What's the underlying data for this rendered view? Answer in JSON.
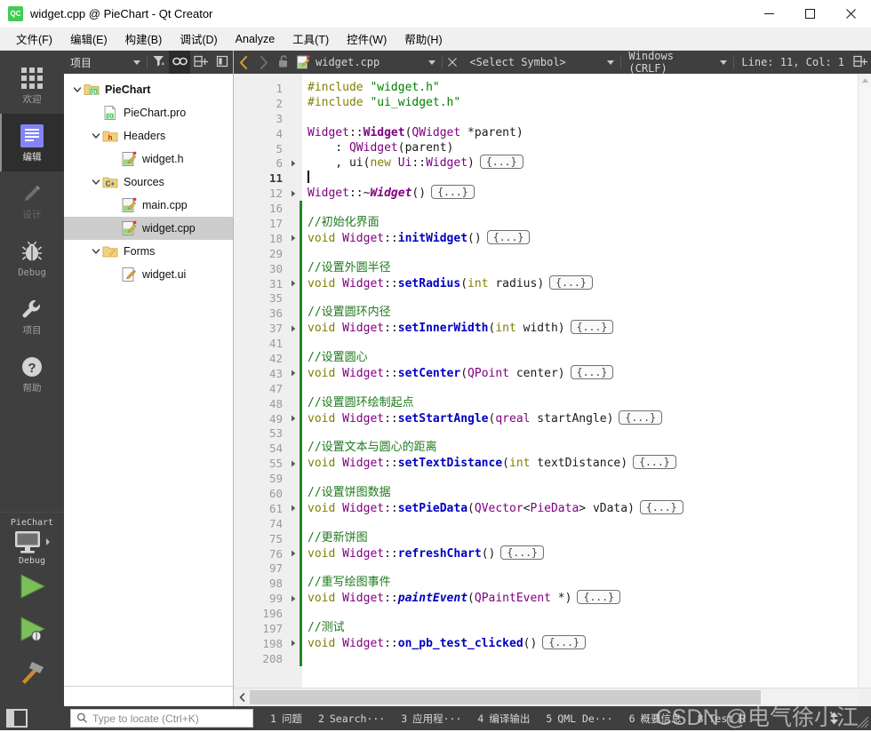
{
  "window": {
    "title": "widget.cpp @ PieChart - Qt Creator",
    "logo_text": "QC",
    "minimize_label": "Minimize",
    "maximize_label": "Maximize",
    "close_label": "Close"
  },
  "menubar": {
    "items": [
      {
        "label": "文件(F)",
        "name": "menu-file"
      },
      {
        "label": "编辑(E)",
        "name": "menu-edit"
      },
      {
        "label": "构建(B)",
        "name": "menu-build"
      },
      {
        "label": "调试(D)",
        "name": "menu-debug"
      },
      {
        "label": "Analyze",
        "name": "menu-analyze"
      },
      {
        "label": "工具(T)",
        "name": "menu-tools"
      },
      {
        "label": "控件(W)",
        "name": "menu-window"
      },
      {
        "label": "帮助(H)",
        "name": "menu-help"
      }
    ]
  },
  "modebar": {
    "modes": [
      {
        "label": "欢迎",
        "icon": "grid-icon",
        "state": "normal"
      },
      {
        "label": "编辑",
        "icon": "edit-lines-icon",
        "state": "active"
      },
      {
        "label": "设计",
        "icon": "pencil-icon",
        "state": "disabled"
      },
      {
        "label": "Debug",
        "icon": "bug-icon",
        "state": "normal"
      },
      {
        "label": "项目",
        "icon": "wrench-icon",
        "state": "normal"
      },
      {
        "label": "帮助",
        "icon": "question-circle-icon",
        "state": "normal"
      }
    ],
    "kit": {
      "project_name": "PieChart",
      "target_icon": "monitor-icon",
      "build_config": "Debug"
    },
    "run_buttons": [
      {
        "name": "run-button",
        "icon": "play-icon"
      },
      {
        "name": "debug-button",
        "icon": "play-bug-icon"
      },
      {
        "name": "build-button",
        "icon": "hammer-icon"
      }
    ]
  },
  "project_panel": {
    "selector_label": "项目",
    "toolbar": [
      {
        "name": "filter-button",
        "icon": "filter-icon",
        "active": false
      },
      {
        "name": "link-with-editor-button",
        "icon": "link-icon",
        "active": true
      },
      {
        "name": "add-split-button",
        "icon": "split-add-icon",
        "active": false
      },
      {
        "name": "close-sidebar-button",
        "icon": "close-panel-icon",
        "active": false
      }
    ],
    "tree": [
      {
        "label": "PieChart",
        "indent": 0,
        "arrow": "down",
        "icon": "qt-project-icon",
        "bold": true,
        "selected": false
      },
      {
        "label": "PieChart.pro",
        "indent": 1,
        "arrow": "none",
        "icon": "pro-file-icon",
        "bold": false,
        "selected": false
      },
      {
        "label": "Headers",
        "indent": 1,
        "arrow": "down",
        "icon": "headers-folder-icon",
        "bold": false,
        "selected": false
      },
      {
        "label": "widget.h",
        "indent": 2,
        "arrow": "none",
        "icon": "source-file-icon",
        "bold": false,
        "selected": false
      },
      {
        "label": "Sources",
        "indent": 1,
        "arrow": "down",
        "icon": "sources-folder-icon",
        "bold": false,
        "selected": false
      },
      {
        "label": "main.cpp",
        "indent": 2,
        "arrow": "none",
        "icon": "source-file-icon",
        "bold": false,
        "selected": false
      },
      {
        "label": "widget.cpp",
        "indent": 2,
        "arrow": "none",
        "icon": "source-file-icon",
        "bold": false,
        "selected": true
      },
      {
        "label": "Forms",
        "indent": 1,
        "arrow": "down",
        "icon": "forms-folder-icon",
        "bold": false,
        "selected": false
      },
      {
        "label": "widget.ui",
        "indent": 2,
        "arrow": "none",
        "icon": "ui-file-icon",
        "bold": false,
        "selected": false
      }
    ]
  },
  "editor_bar": {
    "back_label": "Go Back",
    "forward_label": "Go Forward",
    "lock_label": "Make Writable",
    "filename": "widget.cpp",
    "close_label": "Close Document",
    "symbol_placeholder": "<Select Symbol>",
    "line_ending": "Windows (CRLF)",
    "cursor_position": "Line: 11, Col: 1",
    "split_label": "Split"
  },
  "editor": {
    "line_numbers": [
      "1",
      "2",
      "3",
      "4",
      "5",
      "6",
      "11",
      "12",
      "16",
      "17",
      "18",
      "29",
      "30",
      "31",
      "35",
      "36",
      "37",
      "41",
      "42",
      "43",
      "47",
      "48",
      "49",
      "53",
      "54",
      "55",
      "59",
      "60",
      "61",
      "74",
      "75",
      "76",
      "97",
      "98",
      "99",
      "196",
      "197",
      "198",
      "208"
    ],
    "current_line": "11",
    "fold_marker": "{...}",
    "foldable_lines": [
      "6",
      "12",
      "18",
      "31",
      "37",
      "43",
      "49",
      "55",
      "61",
      "76",
      "99",
      "198"
    ],
    "modified_from_line_index": 8,
    "lines": [
      {
        "n": "1",
        "tokens": [
          {
            "t": "#include ",
            "c": "k-pre"
          },
          {
            "t": "\"widget.h\"",
            "c": "k-str"
          }
        ]
      },
      {
        "n": "2",
        "tokens": [
          {
            "t": "#include ",
            "c": "k-pre"
          },
          {
            "t": "\"ui_widget.h\"",
            "c": "k-str"
          }
        ]
      },
      {
        "n": "3",
        "tokens": []
      },
      {
        "n": "4",
        "tokens": [
          {
            "t": "Widget",
            "c": "k-typ2"
          },
          {
            "t": "::",
            "c": "k-plain"
          },
          {
            "t": "Widget",
            "c": "k-type"
          },
          {
            "t": "(",
            "c": "k-plain"
          },
          {
            "t": "QWidget",
            "c": "k-typ2"
          },
          {
            "t": " *parent)",
            "c": "k-plain"
          }
        ]
      },
      {
        "n": "5",
        "tokens": [
          {
            "t": "    : ",
            "c": "k-plain"
          },
          {
            "t": "QWidget",
            "c": "k-typ2"
          },
          {
            "t": "(parent)",
            "c": "k-plain"
          }
        ]
      },
      {
        "n": "6",
        "tokens": [
          {
            "t": "    , ui(",
            "c": "k-plain"
          },
          {
            "t": "new",
            "c": "k-kw"
          },
          {
            "t": " ",
            "c": "k-plain"
          },
          {
            "t": "Ui",
            "c": "k-typ2"
          },
          {
            "t": "::",
            "c": "k-plain"
          },
          {
            "t": "Widget",
            "c": "k-typ2"
          },
          {
            "t": ")",
            "c": "k-plain"
          }
        ],
        "fold": true
      },
      {
        "n": "11",
        "tokens": [],
        "cursor": true
      },
      {
        "n": "12",
        "tokens": [
          {
            "t": "Widget",
            "c": "k-typ2"
          },
          {
            "t": "::~",
            "c": "k-plain"
          },
          {
            "t": "Widget",
            "c": "k-cls"
          },
          {
            "t": "()",
            "c": "k-plain"
          }
        ],
        "fold": true
      },
      {
        "n": "16",
        "tokens": []
      },
      {
        "n": "17",
        "tokens": [
          {
            "t": "//初始化界面",
            "c": "k-com"
          }
        ]
      },
      {
        "n": "18",
        "tokens": [
          {
            "t": "void",
            "c": "k-kw"
          },
          {
            "t": " ",
            "c": "k-plain"
          },
          {
            "t": "Widget",
            "c": "k-typ2"
          },
          {
            "t": "::",
            "c": "k-plain"
          },
          {
            "t": "initWidget",
            "c": "k-fn"
          },
          {
            "t": "()",
            "c": "k-plain"
          }
        ],
        "fold": true
      },
      {
        "n": "29",
        "tokens": []
      },
      {
        "n": "30",
        "tokens": [
          {
            "t": "//设置外圆半径",
            "c": "k-com"
          }
        ]
      },
      {
        "n": "31",
        "tokens": [
          {
            "t": "void",
            "c": "k-kw"
          },
          {
            "t": " ",
            "c": "k-plain"
          },
          {
            "t": "Widget",
            "c": "k-typ2"
          },
          {
            "t": "::",
            "c": "k-plain"
          },
          {
            "t": "setRadius",
            "c": "k-fn"
          },
          {
            "t": "(",
            "c": "k-plain"
          },
          {
            "t": "int",
            "c": "k-kw"
          },
          {
            "t": " radius)",
            "c": "k-plain"
          }
        ],
        "fold": true
      },
      {
        "n": "35",
        "tokens": []
      },
      {
        "n": "36",
        "tokens": [
          {
            "t": "//设置圆环内径",
            "c": "k-com"
          }
        ]
      },
      {
        "n": "37",
        "tokens": [
          {
            "t": "void",
            "c": "k-kw"
          },
          {
            "t": " ",
            "c": "k-plain"
          },
          {
            "t": "Widget",
            "c": "k-typ2"
          },
          {
            "t": "::",
            "c": "k-plain"
          },
          {
            "t": "setInnerWidth",
            "c": "k-fn"
          },
          {
            "t": "(",
            "c": "k-plain"
          },
          {
            "t": "int",
            "c": "k-kw"
          },
          {
            "t": " width)",
            "c": "k-plain"
          }
        ],
        "fold": true
      },
      {
        "n": "41",
        "tokens": []
      },
      {
        "n": "42",
        "tokens": [
          {
            "t": "//设置圆心",
            "c": "k-com"
          }
        ]
      },
      {
        "n": "43",
        "tokens": [
          {
            "t": "void",
            "c": "k-kw"
          },
          {
            "t": " ",
            "c": "k-plain"
          },
          {
            "t": "Widget",
            "c": "k-typ2"
          },
          {
            "t": "::",
            "c": "k-plain"
          },
          {
            "t": "setCenter",
            "c": "k-fn"
          },
          {
            "t": "(",
            "c": "k-plain"
          },
          {
            "t": "QPoint",
            "c": "k-typ2"
          },
          {
            "t": " center)",
            "c": "k-plain"
          }
        ],
        "fold": true
      },
      {
        "n": "47",
        "tokens": []
      },
      {
        "n": "48",
        "tokens": [
          {
            "t": "//设置圆环绘制起点",
            "c": "k-com"
          }
        ]
      },
      {
        "n": "49",
        "tokens": [
          {
            "t": "void",
            "c": "k-kw"
          },
          {
            "t": " ",
            "c": "k-plain"
          },
          {
            "t": "Widget",
            "c": "k-typ2"
          },
          {
            "t": "::",
            "c": "k-plain"
          },
          {
            "t": "setStartAngle",
            "c": "k-fn"
          },
          {
            "t": "(",
            "c": "k-plain"
          },
          {
            "t": "qreal",
            "c": "k-typ2"
          },
          {
            "t": " startAngle)",
            "c": "k-plain"
          }
        ],
        "fold": true
      },
      {
        "n": "53",
        "tokens": []
      },
      {
        "n": "54",
        "tokens": [
          {
            "t": "//设置文本与圆心的距离",
            "c": "k-com"
          }
        ]
      },
      {
        "n": "55",
        "tokens": [
          {
            "t": "void",
            "c": "k-kw"
          },
          {
            "t": " ",
            "c": "k-plain"
          },
          {
            "t": "Widget",
            "c": "k-typ2"
          },
          {
            "t": "::",
            "c": "k-plain"
          },
          {
            "t": "setTextDistance",
            "c": "k-fn"
          },
          {
            "t": "(",
            "c": "k-plain"
          },
          {
            "t": "int",
            "c": "k-kw"
          },
          {
            "t": " textDistance)",
            "c": "k-plain"
          }
        ],
        "fold": true
      },
      {
        "n": "59",
        "tokens": []
      },
      {
        "n": "60",
        "tokens": [
          {
            "t": "//设置饼图数据",
            "c": "k-com"
          }
        ]
      },
      {
        "n": "61",
        "tokens": [
          {
            "t": "void",
            "c": "k-kw"
          },
          {
            "t": " ",
            "c": "k-plain"
          },
          {
            "t": "Widget",
            "c": "k-typ2"
          },
          {
            "t": "::",
            "c": "k-plain"
          },
          {
            "t": "setPieData",
            "c": "k-fn"
          },
          {
            "t": "(",
            "c": "k-plain"
          },
          {
            "t": "QVector",
            "c": "k-typ2"
          },
          {
            "t": "<",
            "c": "k-plain"
          },
          {
            "t": "PieData",
            "c": "k-typ2"
          },
          {
            "t": "> vData)",
            "c": "k-plain"
          }
        ],
        "fold": true
      },
      {
        "n": "74",
        "tokens": []
      },
      {
        "n": "75",
        "tokens": [
          {
            "t": "//更新饼图",
            "c": "k-com"
          }
        ]
      },
      {
        "n": "76",
        "tokens": [
          {
            "t": "void",
            "c": "k-kw"
          },
          {
            "t": " ",
            "c": "k-plain"
          },
          {
            "t": "Widget",
            "c": "k-typ2"
          },
          {
            "t": "::",
            "c": "k-plain"
          },
          {
            "t": "refreshChart",
            "c": "k-fn"
          },
          {
            "t": "()",
            "c": "k-plain"
          }
        ],
        "fold": true
      },
      {
        "n": "97",
        "tokens": []
      },
      {
        "n": "98",
        "tokens": [
          {
            "t": "//重写绘图事件",
            "c": "k-com"
          }
        ]
      },
      {
        "n": "99",
        "tokens": [
          {
            "t": "void",
            "c": "k-kw"
          },
          {
            "t": " ",
            "c": "k-plain"
          },
          {
            "t": "Widget",
            "c": "k-typ2"
          },
          {
            "t": "::",
            "c": "k-plain"
          },
          {
            "t": "paintEvent",
            "c": "k-fni"
          },
          {
            "t": "(",
            "c": "k-plain"
          },
          {
            "t": "QPaintEvent",
            "c": "k-typ2"
          },
          {
            "t": " *)",
            "c": "k-plain"
          }
        ],
        "fold": true
      },
      {
        "n": "196",
        "tokens": []
      },
      {
        "n": "197",
        "tokens": [
          {
            "t": "//测试",
            "c": "k-com"
          }
        ]
      },
      {
        "n": "198",
        "tokens": [
          {
            "t": "void",
            "c": "k-kw"
          },
          {
            "t": " ",
            "c": "k-plain"
          },
          {
            "t": "Widget",
            "c": "k-typ2"
          },
          {
            "t": "::",
            "c": "k-plain"
          },
          {
            "t": "on_pb_test_clicked",
            "c": "k-fn"
          },
          {
            "t": "()",
            "c": "k-plain"
          }
        ],
        "fold": true
      },
      {
        "n": "208",
        "tokens": []
      }
    ]
  },
  "statusbar": {
    "sidebar_toggle_label": "Toggle Sidebar",
    "locator_placeholder": "Type to locate (Ctrl+K)",
    "tabs": [
      {
        "num": "1",
        "label": "问题"
      },
      {
        "num": "2",
        "label": "Search···"
      },
      {
        "num": "3",
        "label": "应用程···"
      },
      {
        "num": "4",
        "label": "编译输出"
      },
      {
        "num": "5",
        "label": "QML De···"
      },
      {
        "num": "6",
        "label": "概要信息"
      },
      {
        "num": "8",
        "label": "Test R"
      }
    ]
  },
  "watermark": {
    "text": "CSDN @电气徐小江"
  },
  "colors": {
    "chrome_dark": "#3f3f3f",
    "mode_active": "#2e2e2e",
    "accent_qt_green": "#41cd52",
    "selection_gray": "#cdcdcd",
    "modified_green": "#1f8a1f",
    "comment_green": "#1f7a1f",
    "type_purple": "#800080",
    "function_blue": "#0000c0",
    "string_green": "#008000",
    "keyword_olive": "#808000"
  }
}
